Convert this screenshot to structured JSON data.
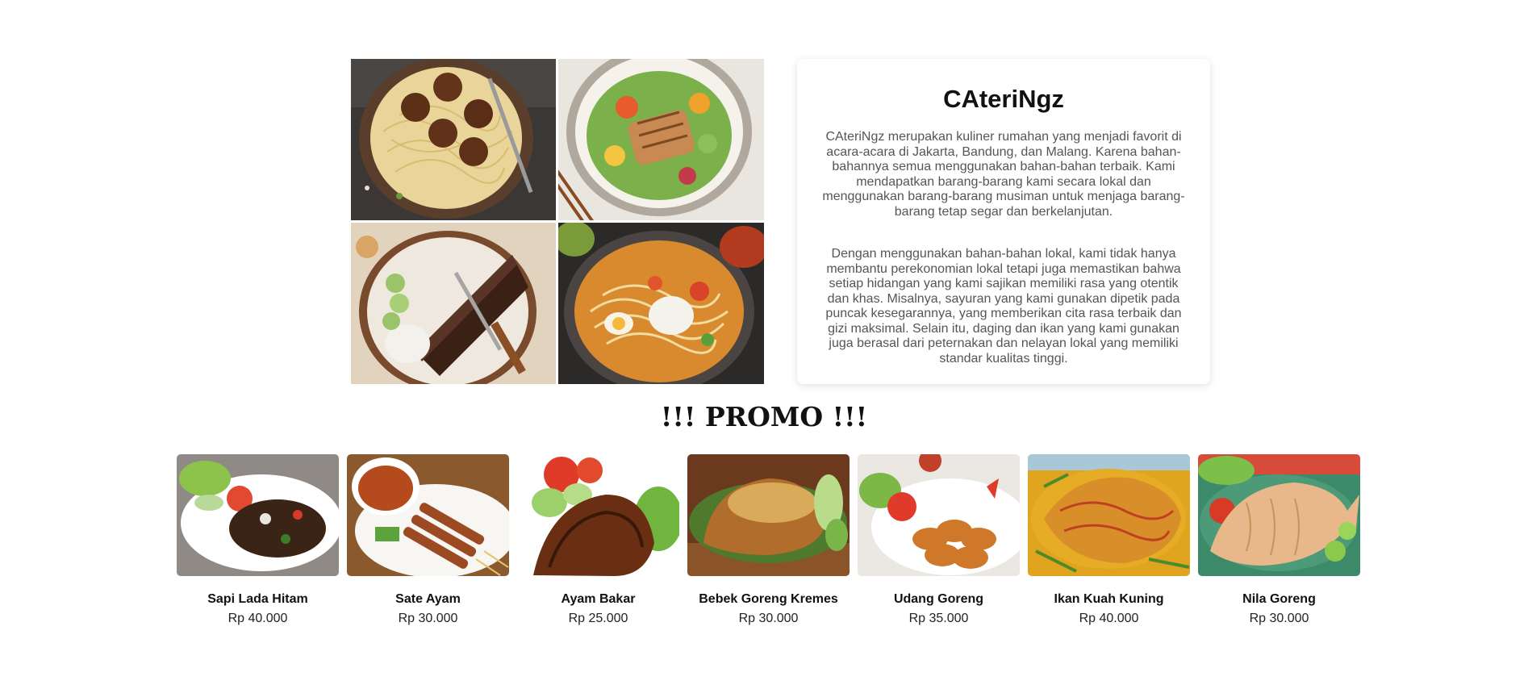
{
  "about": {
    "title": "CAteriNgz",
    "paragraph_1": "CAteriNgz merupakan kuliner rumahan yang menjadi favorit di acara-acara di Jakarta, Bandung, dan Malang. Karena bahan-bahannya semua menggunakan bahan-bahan terbaik. Kami mendapatkan barang-barang kami secara lokal dan menggunakan barang-barang musiman untuk menjaga barang-barang tetap segar dan berkelanjutan.",
    "paragraph_2": "Dengan menggunakan bahan-bahan lokal, kami tidak hanya membantu perekonomian lokal tetapi juga memastikan bahwa setiap hidangan yang kami sajikan memiliki rasa yang otentik dan khas. Misalnya, sayuran yang kami gunakan dipetik pada puncak kesegarannya, yang memberikan cita rasa terbaik dan gizi maksimal. Selain itu, daging dan ikan yang kami gunakan juga berasal dari peternakan dan nelayan lokal yang memiliki standar kualitas tinggi."
  },
  "promo": {
    "title": "!!! PROMO !!!",
    "items": [
      {
        "name": "Sapi Lada Hitam",
        "price": "Rp 40.000"
      },
      {
        "name": "Sate Ayam",
        "price": "Rp 30.000"
      },
      {
        "name": "Ayam Bakar",
        "price": "Rp 25.000"
      },
      {
        "name": "Bebek Goreng Kremes",
        "price": "Rp 30.000"
      },
      {
        "name": "Udang Goreng",
        "price": "Rp 35.000"
      },
      {
        "name": "Ikan Kuah Kuning",
        "price": "Rp 40.000"
      },
      {
        "name": "Nila Goreng",
        "price": "Rp 30.000"
      }
    ]
  }
}
